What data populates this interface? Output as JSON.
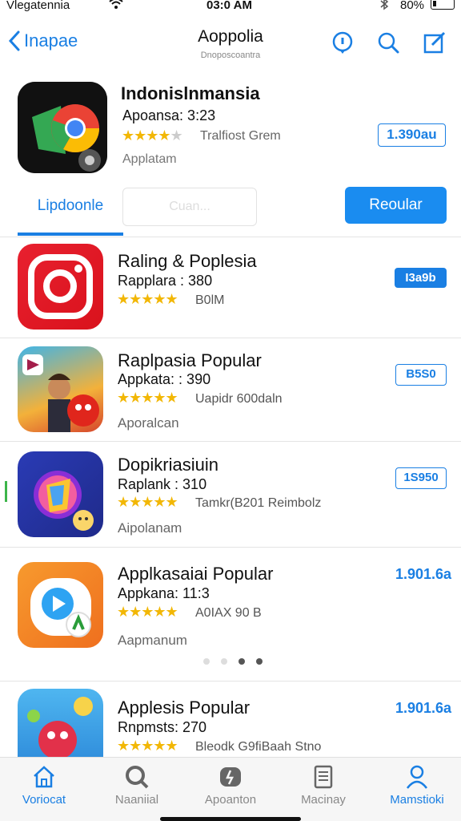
{
  "status": {
    "carrier": "Vlegatennia",
    "time": "03:0 AM",
    "battery": "80%"
  },
  "nav": {
    "back_label": "Inapae",
    "title": "Aoppolia",
    "subtitle": "Dnoposcoantra"
  },
  "featured": {
    "title": "Indonislnmansia",
    "meta": "Apoansa: 3:23",
    "rating": 4,
    "rating_text": "Tralfiost Grem",
    "category": "Applatam",
    "price": "1.390au"
  },
  "tabs": {
    "tab1": "Lipdoonle",
    "tab2": "Cuan...",
    "tab3": "Reoular"
  },
  "apps": [
    {
      "title": "Raling & Poplesia",
      "meta": "Rapplara : 380",
      "rating": 5,
      "rating_text": "B0lM",
      "category": "",
      "price": "I3a9b",
      "price_style": "filled"
    },
    {
      "title": "Raplpasia Popular",
      "meta": "Appkata: : 390",
      "rating": 5,
      "rating_text": "Uapidr 600daln",
      "category": "Aporalcan",
      "price": "B5S0",
      "price_style": "outline"
    },
    {
      "title": "Dopikriasiuin",
      "meta": "Raplank : 310",
      "rating": 5,
      "rating_text": "Tamkr(B201 Reimbolz",
      "category": "Aipolanam",
      "price": "1S950",
      "price_style": "outline"
    },
    {
      "title": "Applkasaiai Popular",
      "meta": "Appkana: 11:3",
      "rating": 5,
      "rating_text": "A0IAX 90 B",
      "category": "Aapmanum",
      "price": "1.901.6a",
      "price_style": "plain"
    },
    {
      "title": "Applesis Popular",
      "meta": "Rnpmsts: 270",
      "rating": 5,
      "rating_text": "Bleodk G9fiBaah Stno",
      "category": "",
      "price": "1.901.6a",
      "price_style": "plain"
    }
  ],
  "bottom_tabs": [
    "Voriocat",
    "Naaniial",
    "Apoanton",
    "Macinay",
    "Mamstioki"
  ],
  "colors": {
    "accent": "#1a7fe3",
    "star": "#f2b705"
  }
}
